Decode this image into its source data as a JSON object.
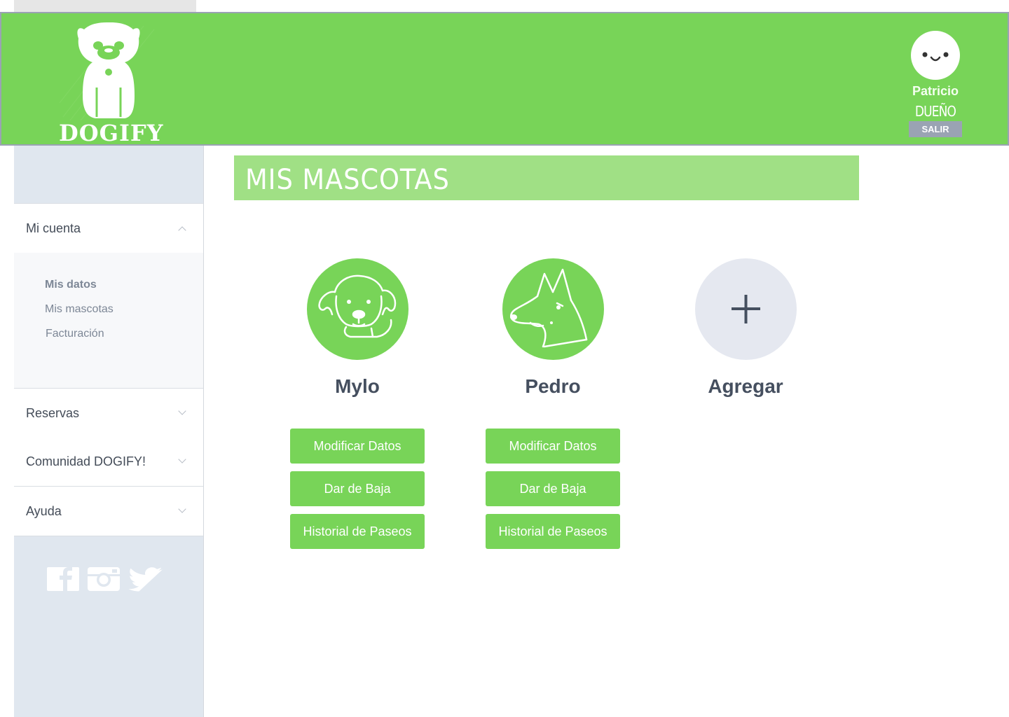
{
  "header": {
    "logo_text": "DOGIFY",
    "user": {
      "name": "Patricio",
      "role": "DUEÑO",
      "logout_label": "SALIR"
    }
  },
  "sidebar": {
    "sections": [
      {
        "label": "Mi cuenta",
        "expanded": true
      },
      {
        "label": "Reservas",
        "expanded": false
      },
      {
        "label": "Comunidad DOGIFY!",
        "expanded": false
      },
      {
        "label": "Ayuda",
        "expanded": false
      }
    ],
    "sub_items": [
      "Mis datos",
      "Mis mascotas",
      "Facturación"
    ],
    "social_icons": [
      "facebook-icon",
      "instagram-icon",
      "twitter-icon"
    ]
  },
  "main": {
    "title": "MIS MASCOTAS",
    "pets": [
      {
        "name": "Mylo",
        "icon": "labrador-icon"
      },
      {
        "name": "Pedro",
        "icon": "german-shepherd-icon"
      }
    ],
    "add_label": "Agregar",
    "add_icon": "plus-icon",
    "buttons": {
      "modify": "Modificar Datos",
      "remove": "Dar de Baja",
      "history": "Historial de Paseos"
    }
  },
  "colors": {
    "brand_green": "#78d458",
    "title_green": "#a0e085",
    "sidebar_bg": "#e0e7ef",
    "text_dark": "#454f5f",
    "logout_grey": "#9aa3b3"
  }
}
